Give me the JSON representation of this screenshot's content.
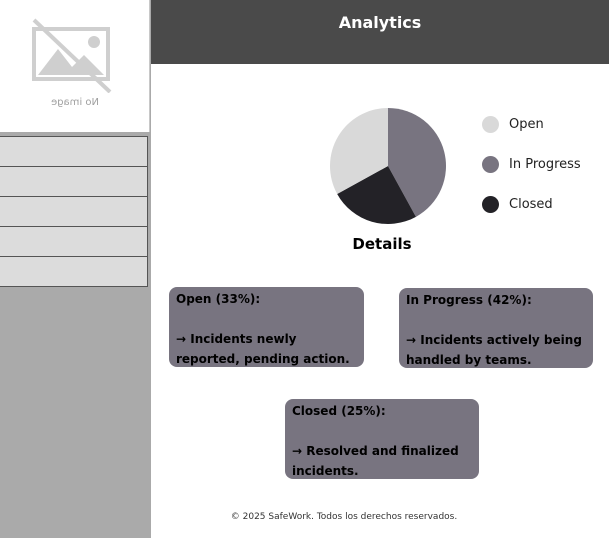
{
  "sidebar": {
    "logo_placeholder": "No image",
    "nav_items": [
      "",
      "",
      "",
      "",
      ""
    ]
  },
  "header": {
    "title": "Analytics"
  },
  "chart_data": {
    "type": "pie",
    "categories": [
      "Open",
      "In Progress",
      "Closed"
    ],
    "values": [
      33,
      42,
      25
    ],
    "colors": [
      "#d9d9d9",
      "#787480",
      "#232227"
    ],
    "legend": "right"
  },
  "details": {
    "title": "Details",
    "cards": [
      {
        "heading": "Open (33%):",
        "text": "→ Incidents newly reported, pending action."
      },
      {
        "heading": "In Progress (42%):",
        "text": "→ Incidents actively being handled by teams."
      },
      {
        "heading": "Closed (25%):",
        "text": "→ Resolved and finalized incidents."
      }
    ]
  },
  "footer": {
    "text": "© 2025 SafeWork. Todos los derechos reservados."
  }
}
